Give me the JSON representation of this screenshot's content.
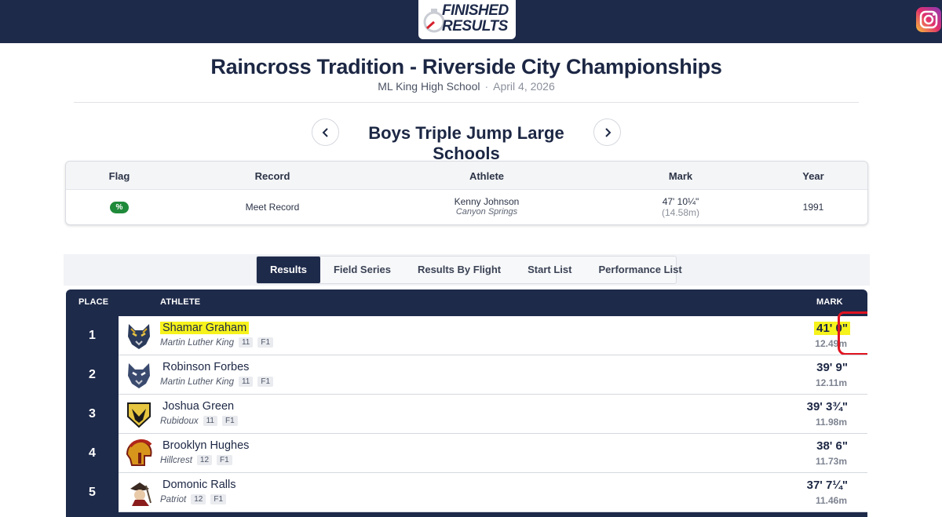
{
  "brand": {
    "logo_line1": "FINISHED",
    "logo_line2": "RESULTS",
    "navy": "#1e2a4a",
    "highlight": "#f6f21c",
    "annotation_red": "#e01421"
  },
  "meet": {
    "title": "Raincross Tradition - Riverside City Championships",
    "venue": "ML King High School",
    "separator": "·",
    "date": "April 4, 2026"
  },
  "event": {
    "title": "Boys Triple Jump Large Schools",
    "prev_icon": "chevron-left-icon",
    "next_icon": "chevron-right-icon"
  },
  "record_table": {
    "headers": {
      "flag": "Flag",
      "record": "Record",
      "athlete": "Athlete",
      "mark": "Mark",
      "year": "Year"
    },
    "row": {
      "flag": "%",
      "record": "Meet Record",
      "athlete": "Kenny Johnson",
      "school": "Canyon Springs",
      "mark": "47' 10¼\"",
      "metric": "(14.58m)",
      "year": "1991"
    }
  },
  "tabs": [
    {
      "label": "Results",
      "active": true
    },
    {
      "label": "Field Series",
      "active": false
    },
    {
      "label": "Results By Flight",
      "active": false
    },
    {
      "label": "Start List",
      "active": false
    },
    {
      "label": "Performance List",
      "active": false
    }
  ],
  "results": {
    "headers": {
      "place": "PLACE",
      "athlete": "ATHLETE",
      "mark": "MARK"
    },
    "rows": [
      {
        "place": "1",
        "name": "Shamar Graham",
        "school": "Martin Luther King",
        "grade": "11",
        "flight": "F1",
        "mark": "41' 0\"",
        "metric": "12.49m",
        "logo": "wolf-logo-icon",
        "highlighted": true
      },
      {
        "place": "2",
        "name": "Robinson Forbes",
        "school": "Martin Luther King",
        "grade": "11",
        "flight": "F1",
        "mark": "39' 9\"",
        "metric": "12.11m",
        "logo": "wolf-logo-icon",
        "highlighted": false
      },
      {
        "place": "3",
        "name": "Joshua Green",
        "school": "Rubidoux",
        "grade": "11",
        "flight": "F1",
        "mark": "39' 3¾\"",
        "metric": "11.98m",
        "logo": "falcon-logo-icon",
        "highlighted": false
      },
      {
        "place": "4",
        "name": "Brooklyn Hughes",
        "school": "Hillcrest",
        "grade": "12",
        "flight": "F1",
        "mark": "38' 6\"",
        "metric": "11.73m",
        "logo": "trojan-helmet-logo-icon",
        "highlighted": false
      },
      {
        "place": "5",
        "name": "Domonic Ralls",
        "school": "Patriot",
        "grade": "12",
        "flight": "F1",
        "mark": "37' 7¼\"",
        "metric": "11.46m",
        "logo": "patriot-logo-icon",
        "highlighted": false
      }
    ]
  }
}
